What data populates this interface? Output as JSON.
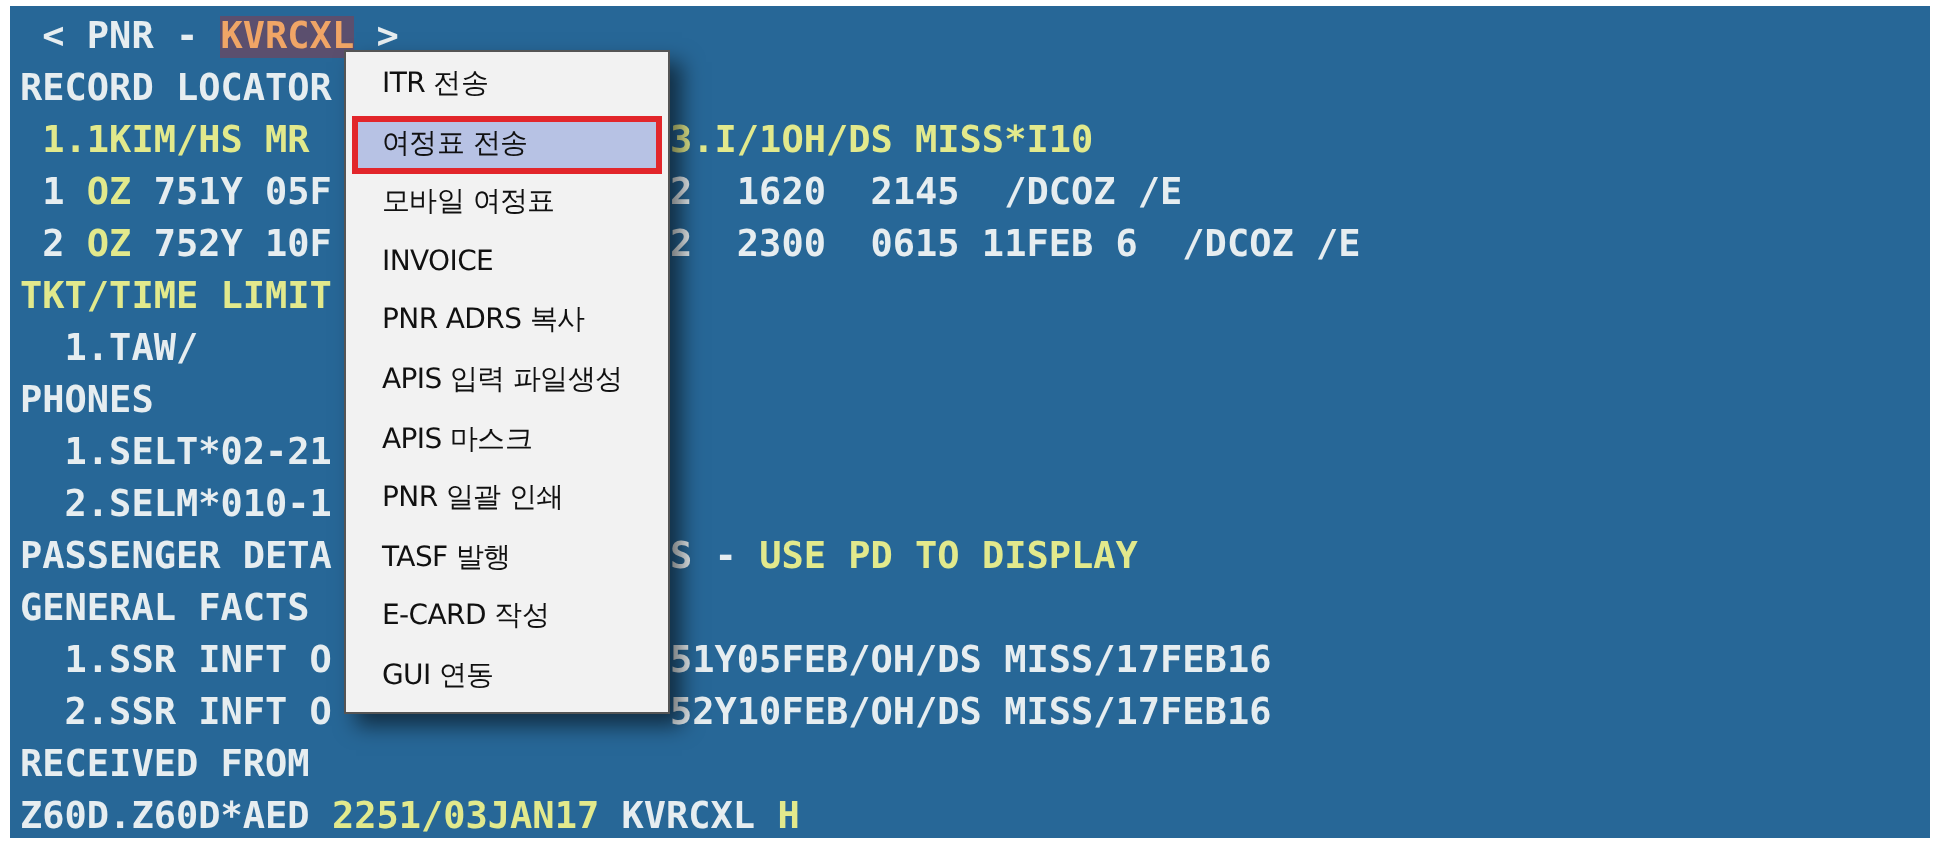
{
  "terminal": {
    "lines": [
      {
        "left": [
          {
            "text": " < PNR - ",
            "kind": "plain"
          },
          {
            "text": "KVRCXL",
            "kind": "locator"
          },
          {
            "text": " >",
            "kind": "plain"
          }
        ]
      },
      {
        "left": [
          {
            "text": "RECORD LOCATOR",
            "kind": "plain"
          }
        ]
      },
      {
        "left": [
          {
            "text": " 1.1KIM/HS MR",
            "kind": "hl"
          }
        ],
        "right": [
          {
            "text": "3.I/1OH/DS MISS*I10",
            "kind": "hl"
          }
        ]
      },
      {
        "left": [
          {
            "text": " 1 ",
            "kind": "plain"
          },
          {
            "text": "OZ",
            "kind": "hl"
          },
          {
            "text": " 751Y 05F",
            "kind": "plain"
          }
        ],
        "right": [
          {
            "text": "2  1620  2145  /DCOZ /E",
            "kind": "plain"
          }
        ]
      },
      {
        "left": [
          {
            "text": " 2 ",
            "kind": "plain"
          },
          {
            "text": "OZ",
            "kind": "hl"
          },
          {
            "text": " 752Y 10F",
            "kind": "plain"
          }
        ],
        "right": [
          {
            "text": "2  2300  0615 11FEB 6  /DCOZ /E",
            "kind": "plain"
          }
        ]
      },
      {
        "left": [
          {
            "text": "TKT/TIME LIMIT",
            "kind": "hl"
          }
        ]
      },
      {
        "left": [
          {
            "text": "  1.TAW/",
            "kind": "plain"
          }
        ]
      },
      {
        "left": [
          {
            "text": "PHONES",
            "kind": "plain"
          }
        ]
      },
      {
        "left": [
          {
            "text": "  1.SELT*02-21",
            "kind": "plain"
          }
        ]
      },
      {
        "left": [
          {
            "text": "  2.SELM*010-1",
            "kind": "plain"
          }
        ]
      },
      {
        "left": [
          {
            "text": "PASSENGER DETA",
            "kind": "plain"
          }
        ],
        "right": [
          {
            "text": "S - ",
            "kind": "plain"
          },
          {
            "text": "USE PD TO DISPLAY",
            "kind": "hl"
          }
        ]
      },
      {
        "left": [
          {
            "text": "GENERAL FACTS",
            "kind": "plain"
          }
        ]
      },
      {
        "left": [
          {
            "text": "  1.SSR INFT O",
            "kind": "plain"
          }
        ],
        "right": [
          {
            "text": "51Y05FEB/OH/DS MISS/17FEB16",
            "kind": "plain"
          }
        ]
      },
      {
        "left": [
          {
            "text": "  2.SSR INFT O",
            "kind": "plain"
          }
        ],
        "right": [
          {
            "text": "52Y10FEB/OH/DS MISS/17FEB16",
            "kind": "plain"
          }
        ]
      },
      {
        "left": [
          {
            "text": "RECEIVED FROM",
            "kind": "plain"
          }
        ]
      },
      {
        "left": [
          {
            "text": "Z60D.Z60D*AED ",
            "kind": "plain"
          },
          {
            "text": "2251/03JAN17",
            "kind": "hl"
          },
          {
            "text": " KVRCXL ",
            "kind": "plain"
          },
          {
            "text": "H",
            "kind": "hl"
          }
        ]
      }
    ]
  },
  "context_menu": {
    "items": [
      {
        "label": "ITR 전송",
        "selected": false
      },
      {
        "label": "여정표 전송",
        "selected": true
      },
      {
        "label": "모바일 여정표",
        "selected": false
      },
      {
        "label": "INVOICE",
        "selected": false
      },
      {
        "label": "PNR ADRS 복사",
        "selected": false
      },
      {
        "label": "APIS 입력 파일생성",
        "selected": false
      },
      {
        "label": "APIS 마스크",
        "selected": false
      },
      {
        "label": "PNR 일괄 인쇄",
        "selected": false
      },
      {
        "label": "TASF 발행",
        "selected": false
      },
      {
        "label": "E-CARD 작성",
        "selected": false
      },
      {
        "label": "GUI 연동",
        "selected": false
      }
    ]
  }
}
